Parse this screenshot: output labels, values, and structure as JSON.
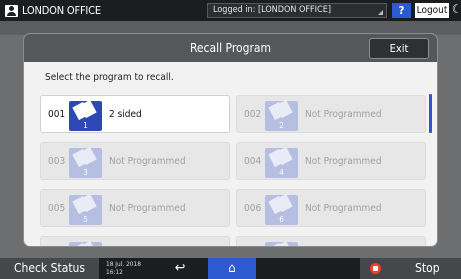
{
  "topbar": {
    "office_name": "LONDON OFFICE",
    "login_status": "Logged in: [LONDON OFFICE]",
    "help_label": "?",
    "logout_label": "Logout"
  },
  "dialog": {
    "title": "Recall Program",
    "exit_label": "Exit",
    "prompt": "Select the program to recall."
  },
  "programs": [
    {
      "number": "001",
      "icon_number": "1",
      "label": "2 sided",
      "selected": true
    },
    {
      "number": "002",
      "icon_number": "2",
      "label": "Not Programmed"
    },
    {
      "number": "003",
      "icon_number": "3",
      "label": "Not Programmed"
    },
    {
      "number": "004",
      "icon_number": "4",
      "label": "Not Programmed"
    },
    {
      "number": "005",
      "icon_number": "5",
      "label": "Not Programmed"
    },
    {
      "number": "006",
      "icon_number": "6",
      "label": "Not Programmed"
    }
  ],
  "bottombar": {
    "check_status_label": "Check Status",
    "date": "18 Jul. 2018",
    "time": "16:12",
    "stop_label": "Stop"
  },
  "colors": {
    "accent": "#2d5bcf",
    "selected_icon": "#2d49b5",
    "stop": "#e8432d"
  }
}
